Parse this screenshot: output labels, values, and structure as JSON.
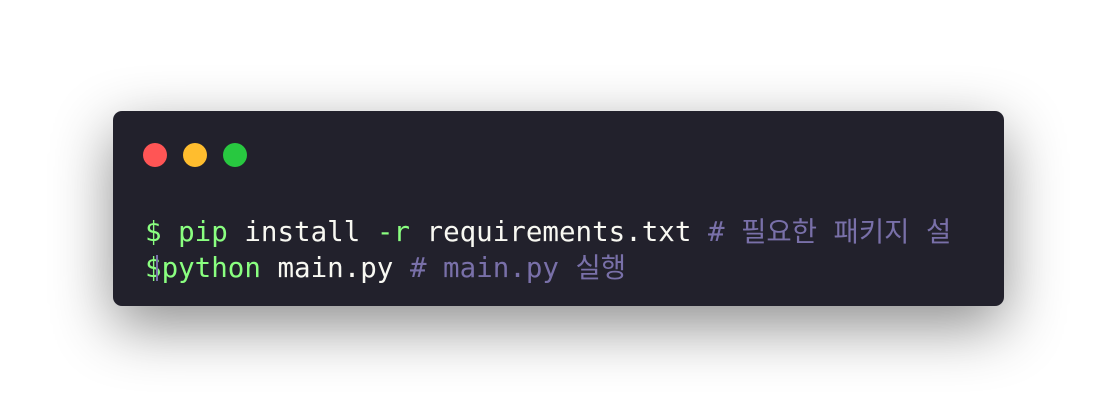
{
  "window": {
    "background": "#22212c",
    "buttons": [
      {
        "name": "close",
        "color": "#ff5555"
      },
      {
        "name": "minimize",
        "color": "#ffbd2e"
      },
      {
        "name": "maximize",
        "color": "#28c840"
      }
    ]
  },
  "colors": {
    "command": "#8aff80",
    "text": "#f8f8f2",
    "comment": "#7970a9"
  },
  "lines": [
    {
      "prompt": "$",
      "command": "pip",
      "args": "install",
      "flag": "-r",
      "file": "requirements.txt",
      "comment": "# 필요한 패키지 설"
    },
    {
      "prompt": "$",
      "command": "python",
      "args": "main.py",
      "comment": "# main.py 실행"
    }
  ]
}
